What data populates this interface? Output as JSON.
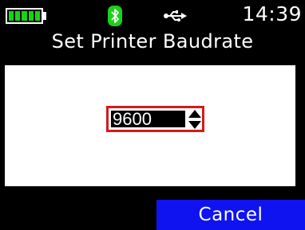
{
  "status": {
    "battery_level": 1.0,
    "battery_color": "#19d219",
    "bluetooth_icon": "bluetooth-icon",
    "bluetooth_color": "#19d219",
    "usb_icon": "usb-icon",
    "time": "14:39"
  },
  "screen": {
    "title": "Set Printer Baudrate"
  },
  "baudrate": {
    "value": "9600",
    "stepper_icon": "up-down-arrows-icon",
    "highlight_color": "#d51a1a"
  },
  "softkeys": {
    "right_label": "Cancel",
    "right_color": "#0e13f0"
  }
}
